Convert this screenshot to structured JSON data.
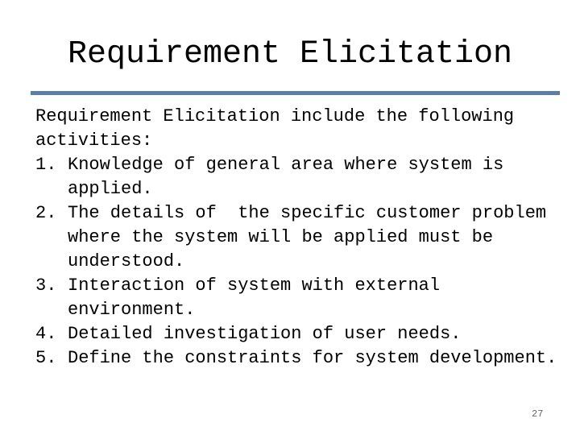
{
  "slide": {
    "title": "Requirement Elicitation",
    "intro": "Requirement Elicitation include the following activities:",
    "items": [
      {
        "num": "1.",
        "text": "Knowledge of general area where system is applied."
      },
      {
        "num": "2.",
        "text": "The details of  the specific customer problem where the system will be applied must be understood."
      },
      {
        "num": "3.",
        "text": "Interaction of system with external environment."
      },
      {
        "num": "4.",
        "text": "Detailed investigation of user needs."
      },
      {
        "num": "5.",
        "text": "Define the constraints for system development."
      }
    ],
    "page_number": "27",
    "accent_color": "#5a7fa3"
  }
}
